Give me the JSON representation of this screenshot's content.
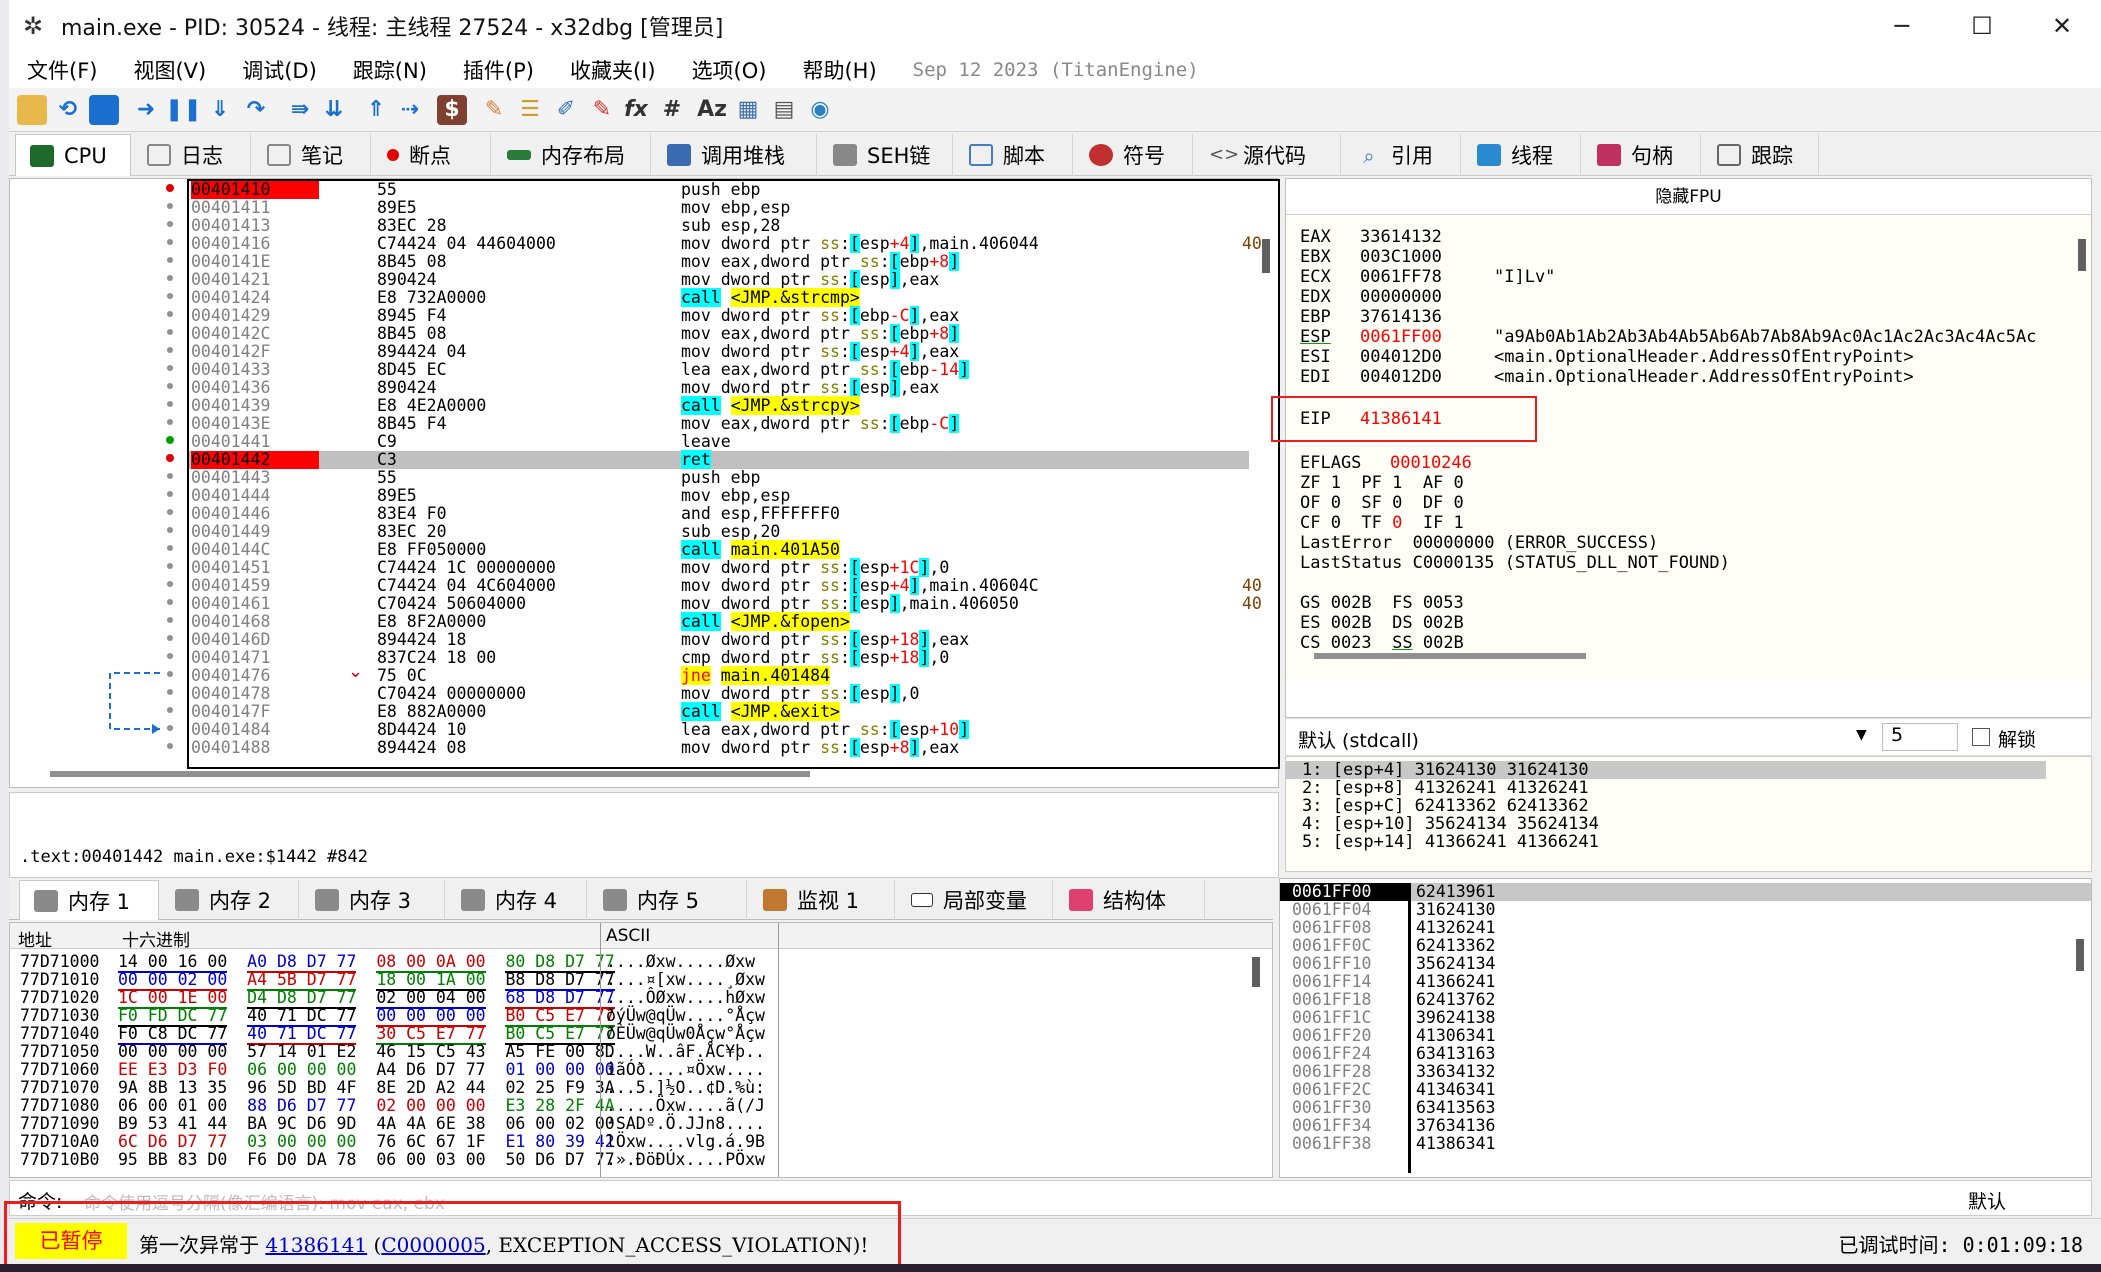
{
  "window": {
    "title": "main.exe - PID: 30524 - 线程: 主线程 27524 - x32dbg [管理员]",
    "minimize": "─",
    "maximize": "☐",
    "close": "✕"
  },
  "menu": [
    "文件(F)",
    "视图(V)",
    "调试(D)",
    "跟踪(N)",
    "插件(P)",
    "收藏夹(I)",
    "选项(O)",
    "帮助(H)"
  ],
  "build_date": "Sep 12 2023 (TitanEngine)",
  "tabs": [
    "CPU",
    "日志",
    "笔记",
    "断点",
    "内存布局",
    "调用堆栈",
    "SEH链",
    "脚本",
    "符号",
    "源代码",
    "引用",
    "线程",
    "句柄",
    "跟踪"
  ],
  "disasm": [
    {
      "addr": "00401410",
      "bytes": "55",
      "asm": "push ebp",
      "bp": true
    },
    {
      "addr": "00401411",
      "bytes": "89E5",
      "asm": "mov ebp,esp"
    },
    {
      "addr": "00401413",
      "bytes": "83EC 28",
      "asm": "sub esp,28"
    },
    {
      "addr": "00401416",
      "bytes": "C74424 04 44604000",
      "asm": "mov dword ptr ss:[esp+4],main.406044",
      "cmt": "40"
    },
    {
      "addr": "0040141E",
      "bytes": "8B45 08",
      "asm": "mov eax,dword ptr ss:[ebp+8]"
    },
    {
      "addr": "00401421",
      "bytes": "890424",
      "asm": "mov dword ptr ss:[esp],eax"
    },
    {
      "addr": "00401424",
      "bytes": "E8 732A0000",
      "asm": "call <JMP.&strcmp>"
    },
    {
      "addr": "00401429",
      "bytes": "8945 F4",
      "asm": "mov dword ptr ss:[ebp-C],eax"
    },
    {
      "addr": "0040142C",
      "bytes": "8B45 08",
      "asm": "mov eax,dword ptr ss:[ebp+8]"
    },
    {
      "addr": "0040142F",
      "bytes": "894424 04",
      "asm": "mov dword ptr ss:[esp+4],eax"
    },
    {
      "addr": "00401433",
      "bytes": "8D45 EC",
      "asm": "lea eax,dword ptr ss:[ebp-14]"
    },
    {
      "addr": "00401436",
      "bytes": "890424",
      "asm": "mov dword ptr ss:[esp],eax"
    },
    {
      "addr": "00401439",
      "bytes": "E8 4E2A0000",
      "asm": "call <JMP.&strcpy>"
    },
    {
      "addr": "0040143E",
      "bytes": "8B45 F4",
      "asm": "mov eax,dword ptr ss:[ebp-C]"
    },
    {
      "addr": "00401441",
      "bytes": "C9",
      "asm": "leave"
    },
    {
      "addr": "00401442",
      "bytes": "C3",
      "asm": "ret",
      "bp": true,
      "cur": true
    },
    {
      "addr": "00401443",
      "bytes": "55",
      "asm": "push ebp"
    },
    {
      "addr": "00401444",
      "bytes": "89E5",
      "asm": "mov ebp,esp"
    },
    {
      "addr": "00401446",
      "bytes": "83E4 F0",
      "asm": "and esp,FFFFFFF0"
    },
    {
      "addr": "00401449",
      "bytes": "83EC 20",
      "asm": "sub esp,20"
    },
    {
      "addr": "0040144C",
      "bytes": "E8 FF050000",
      "asm": "call main.401A50"
    },
    {
      "addr": "00401451",
      "bytes": "C74424 1C 00000000",
      "asm": "mov dword ptr ss:[esp+1C],0"
    },
    {
      "addr": "00401459",
      "bytes": "C74424 04 4C604000",
      "asm": "mov dword ptr ss:[esp+4],main.40604C",
      "cmt": "40"
    },
    {
      "addr": "00401461",
      "bytes": "C70424 50604000",
      "asm": "mov dword ptr ss:[esp],main.406050",
      "cmt": "40"
    },
    {
      "addr": "00401468",
      "bytes": "E8 8F2A0000",
      "asm": "call <JMP.&fopen>"
    },
    {
      "addr": "0040146D",
      "bytes": "894424 18",
      "asm": "mov dword ptr ss:[esp+18],eax"
    },
    {
      "addr": "00401471",
      "bytes": "837C24 18 00",
      "asm": "cmp dword ptr ss:[esp+18],0"
    },
    {
      "addr": "00401476",
      "bytes": "75 0C",
      "asm": "jne main.401484"
    },
    {
      "addr": "00401478",
      "bytes": "C70424 00000000",
      "asm": "mov dword ptr ss:[esp],0"
    },
    {
      "addr": "0040147F",
      "bytes": "E8 882A0000",
      "asm": "call <JMP.&exit>"
    },
    {
      "addr": "00401484",
      "bytes": "8D4424 10",
      "asm": "lea eax,dword ptr ss:[esp+10]"
    },
    {
      "addr": "00401488",
      "bytes": "894424 08",
      "asm": "mov dword ptr ss:[esp+8],eax"
    }
  ],
  "info_line": ".text:00401442 main.exe:$1442 #842",
  "registers": {
    "header": "隐藏FPU",
    "gp": [
      {
        "n": "EAX",
        "v": "33614132",
        "s": ""
      },
      {
        "n": "EBX",
        "v": "003C1000",
        "s": ""
      },
      {
        "n": "ECX",
        "v": "0061FF78",
        "s": "\"I]Lv\""
      },
      {
        "n": "EDX",
        "v": "00000000",
        "s": ""
      },
      {
        "n": "EBP",
        "v": "37614136",
        "s": ""
      },
      {
        "n": "ESP",
        "v": "0061FF00",
        "s": "\"a9Ab0Ab1Ab2Ab3Ab4Ab5Ab6Ab7Ab8Ab9Ac0Ac1Ac2Ac3Ac4Ac5Ac",
        "red": true
      },
      {
        "n": "ESI",
        "v": "004012D0",
        "s": "<main.OptionalHeader.AddressOfEntryPoint>"
      },
      {
        "n": "EDI",
        "v": "004012D0",
        "s": "<main.OptionalHeader.AddressOfEntryPoint>"
      }
    ],
    "eip": {
      "n": "EIP",
      "v": "41386141"
    },
    "eflags": {
      "n": "EFLAGS",
      "v": "00010246"
    },
    "flags": [
      "ZF 1  PF 1  AF 0",
      "OF 0  SF 0  DF 0",
      "CF 0  TF 0  IF 1"
    ],
    "lasterror": "LastError  00000000 (ERROR_SUCCESS)",
    "laststatus": "LastStatus C0000135 (STATUS_DLL_NOT_FOUND)",
    "segs": [
      "GS 002B  FS 0053",
      "ES 002B  DS 002B",
      "CS 0023  SS 002B"
    ]
  },
  "callconv": {
    "label": "默认 (stdcall)",
    "count": "5",
    "unlock": "解锁"
  },
  "callstack": [
    "1: [esp+4] 31624130 31624130",
    "2: [esp+8] 41326241 41326241",
    "3: [esp+C] 62413362 62413362",
    "4: [esp+10] 35624134 35624134",
    "5: [esp+14] 41366241 41366241"
  ],
  "memtabs": [
    "内存 1",
    "内存 2",
    "内存 3",
    "内存 4",
    "内存 5",
    "监视 1",
    "局部变量",
    "结构体"
  ],
  "dump_headers": {
    "addr": "地址",
    "hex": "十六进制",
    "ascii": "ASCII"
  },
  "dump": [
    {
      "a": "77D71000",
      "h": "14 00 16 00  A0 D8 D7 77  08 00 0A 00  80 D8 D7 77",
      "t": "....Øxw.....Øxw"
    },
    {
      "a": "77D71010",
      "h": "00 00 02 00  A4 5B D7 77  18 00 1A 00  B8 D8 D7 77",
      "t": "....¤[xw....¸Øxw"
    },
    {
      "a": "77D71020",
      "h": "1C 00 1E 00  D4 D8 D7 77  02 00 04 00  68 D8 D7 77",
      "t": "....ÔØxw....hØxw"
    },
    {
      "a": "77D71030",
      "h": "F0 FD DC 77  40 71 DC 77  00 00 00 00  B0 C5 E7 77",
      "t": "ðýÜw@qÜw....°Åçw"
    },
    {
      "a": "77D71040",
      "h": "F0 C8 DC 77  40 71 DC 77  30 C5 E7 77  B0 C5 E7 77",
      "t": "ðÈÜw@qÜw0Åçw°Åçw"
    },
    {
      "a": "77D71050",
      "h": "00 00 00 00  57 14 01 E2  46 15 C5 43  A5 FE 00 8D",
      "t": "....W..âF.ÅC¥þ.."
    },
    {
      "a": "77D71060",
      "h": "EE E3 D3 F0  06 00 00 00  A4 D6 D7 77  01 00 00 00",
      "t": "îãÓð....¤Öxw...."
    },
    {
      "a": "77D71070",
      "h": "9A 8B 13 35  96 5D BD 4F  8E 2D A2 44  02 25 F9 3A",
      "t": "...5.]½O..¢D.%ù:"
    },
    {
      "a": "77D71080",
      "h": "06 00 01 00  88 D6 D7 77  02 00 00 00  E3 28 2F 4A",
      "t": ".....Öxw....ã(/J"
    },
    {
      "a": "77D71090",
      "h": "B9 53 41 44  BA 9C D6 9D  4A 4A 6E 38  06 00 02 00",
      "t": "¹SADº.Ö.JJn8...."
    },
    {
      "a": "77D710A0",
      "h": "6C D6 D7 77  03 00 00 00  76 6C 67 1F  E1 80 39 42",
      "t": "lÖxw....vlg.á.9B"
    },
    {
      "a": "77D710B0",
      "h": "95 BB 83 D0  F6 D0 DA 78  06 00 03 00  50 D6 D7 77",
      "t": ".».ÐöÐÚx....PÖxw"
    }
  ],
  "stack": [
    {
      "a": "0061FF00",
      "v": "62413961",
      "cur": true
    },
    {
      "a": "0061FF04",
      "v": "31624130"
    },
    {
      "a": "0061FF08",
      "v": "41326241"
    },
    {
      "a": "0061FF0C",
      "v": "62413362"
    },
    {
      "a": "0061FF10",
      "v": "35624134"
    },
    {
      "a": "0061FF14",
      "v": "41366241"
    },
    {
      "a": "0061FF18",
      "v": "62413762"
    },
    {
      "a": "0061FF1C",
      "v": "39624138"
    },
    {
      "a": "0061FF20",
      "v": "41306341"
    },
    {
      "a": "0061FF24",
      "v": "63413163"
    },
    {
      "a": "0061FF28",
      "v": "33634132"
    },
    {
      "a": "0061FF2C",
      "v": "41346341"
    },
    {
      "a": "0061FF30",
      "v": "63413563"
    },
    {
      "a": "0061FF34",
      "v": "37634136"
    },
    {
      "a": "0061FF38",
      "v": "41386341"
    }
  ],
  "cmd": {
    "label": "命令:",
    "placeholder": "命令使用逗号分隔(像汇编语言): mov eax, ebx",
    "mode": "默认"
  },
  "status": {
    "paused": "已暂停",
    "prefix": "第一次异常于 ",
    "addr": "41386141",
    "mid": " (",
    "code": "C0000005",
    "suffix": ", EXCEPTION_ACCESS_VIOLATION)!",
    "elapsed_label": "已调试时间:",
    "elapsed": "0:01:09:18"
  }
}
